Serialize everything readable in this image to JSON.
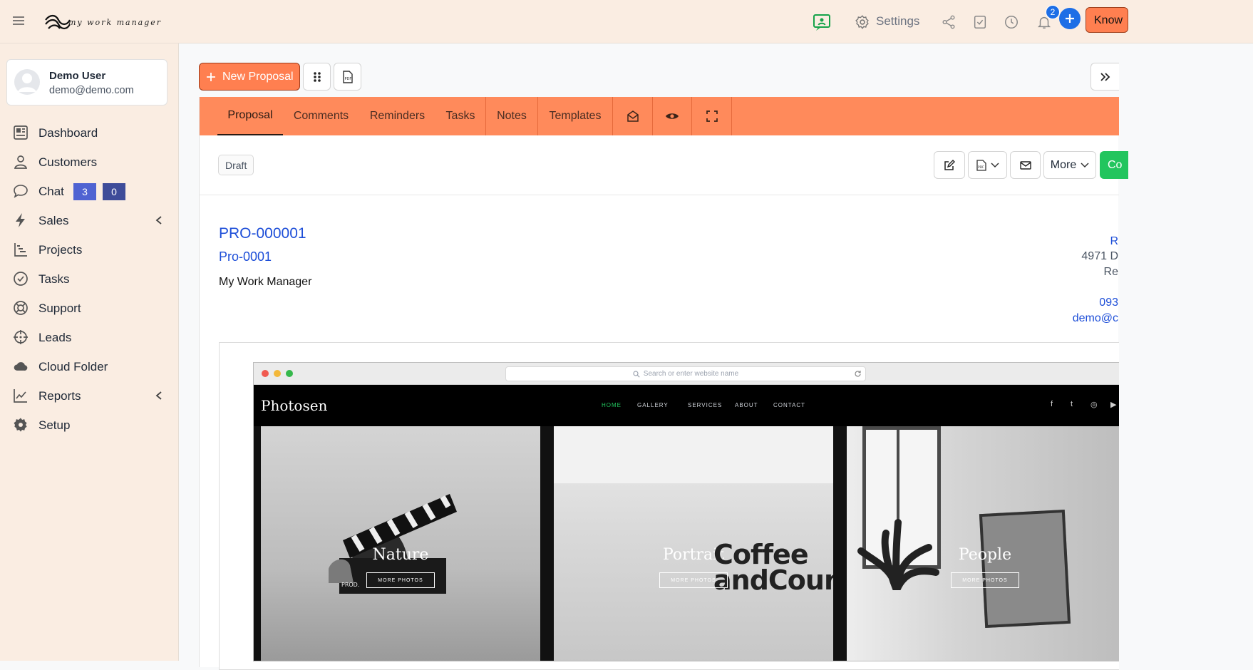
{
  "topbar": {
    "logo_text": "my work manager",
    "settings_label": "Settings",
    "notification_count": "2",
    "know_button_label": "Know"
  },
  "user": {
    "name": "Demo User",
    "email": "demo@demo.com"
  },
  "sidebar": {
    "items": [
      {
        "label": "Dashboard",
        "icon": "dashboard-icon"
      },
      {
        "label": "Customers",
        "icon": "user-icon"
      },
      {
        "label": "Chat",
        "icon": "chat-icon"
      },
      {
        "label": "Sales",
        "icon": "bolt-icon"
      },
      {
        "label": "Projects",
        "icon": "projects-icon"
      },
      {
        "label": "Tasks",
        "icon": "check-circle-icon"
      },
      {
        "label": "Support",
        "icon": "lifebuoy-icon"
      },
      {
        "label": "Leads",
        "icon": "crosshair-icon"
      },
      {
        "label": "Cloud Folder",
        "icon": "cloud-icon"
      },
      {
        "label": "Reports",
        "icon": "chart-line-icon"
      },
      {
        "label": "Setup",
        "icon": "gear-icon"
      }
    ],
    "chat_badges": [
      "3",
      "0"
    ]
  },
  "toolbar": {
    "new_proposal_label": "New Proposal"
  },
  "tabs": [
    "Proposal",
    "Comments",
    "Reminders",
    "Tasks",
    "Notes",
    "Templates"
  ],
  "status": {
    "badge": "Draft",
    "more_label": "More",
    "green_button_label": "Co"
  },
  "proposal": {
    "number": "PRO-000001",
    "subject": "Pro-0001",
    "company": "My Work Manager",
    "address_line1": "R",
    "address_line2": "4971 D",
    "address_line3": "Re",
    "phone": "093",
    "email": "demo@c"
  },
  "preview": {
    "url_placeholder": "Search or enter website name",
    "brand": "Photosen",
    "nav": [
      "HOME",
      "GALLERY",
      "SERVICES",
      "ABOUT",
      "CONTACT"
    ],
    "social": [
      "f",
      "t",
      "◎",
      "▶"
    ],
    "photos": [
      {
        "label": "Nature",
        "button": "MORE PHOTOS"
      },
      {
        "label": "Portrait",
        "button": "MORE PHOTOS",
        "overlay": "Coffee",
        "overlay2": "andCoun"
      },
      {
        "label": "People",
        "button": "MORE PHOTOS"
      }
    ],
    "clapper_text": "PROD."
  },
  "colors": {
    "accent": "#ff7f50",
    "tab_bar": "#ff8a5b",
    "sidebar_bg": "#faede2",
    "link": "#1d4ed8",
    "chat_badge_1": "#4f63d2",
    "chat_badge_2": "#3e4c99",
    "primary_blue": "#1d6ee6",
    "success": "#22c55e"
  }
}
